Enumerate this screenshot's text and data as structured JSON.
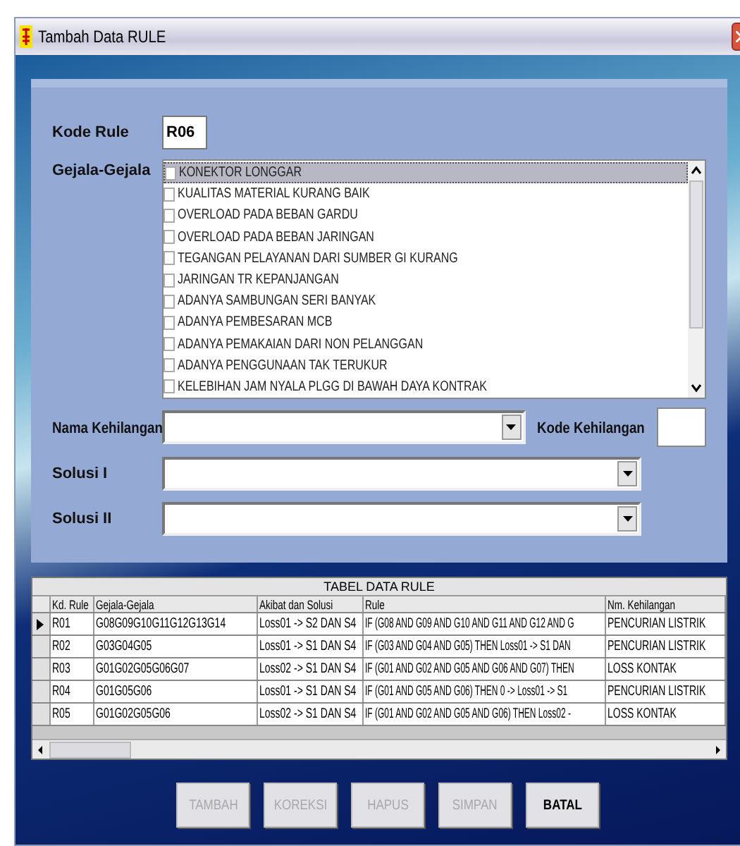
{
  "window": {
    "title": "Tambah Data RULE"
  },
  "form": {
    "kode_rule": {
      "label": "Kode Rule",
      "value": "R06"
    },
    "gejala": {
      "label": "Gejala-Gejala",
      "items": [
        {
          "label": "KONEKTOR LONGGAR",
          "checked": false,
          "selected": true
        },
        {
          "label": "KUALITAS MATERIAL KURANG BAIK",
          "checked": false,
          "selected": false
        },
        {
          "label": "OVERLOAD PADA BEBAN GARDU",
          "checked": false,
          "selected": false
        },
        {
          "label": "OVERLOAD PADA BEBAN JARINGAN",
          "checked": false,
          "selected": false
        },
        {
          "label": "TEGANGAN PELAYANAN DARI SUMBER GI KURANG",
          "checked": false,
          "selected": false
        },
        {
          "label": "JARINGAN TR KEPANJANGAN",
          "checked": false,
          "selected": false
        },
        {
          "label": "ADANYA SAMBUNGAN SERI BANYAK",
          "checked": false,
          "selected": false
        },
        {
          "label": "ADANYA PEMBESARAN MCB",
          "checked": false,
          "selected": false
        },
        {
          "label": "ADANYA PEMAKAIAN DARI NON PELANGGAN",
          "checked": false,
          "selected": false
        },
        {
          "label": "ADANYA PENGGUNAAN TAK TERUKUR",
          "checked": false,
          "selected": false
        },
        {
          "label": "KELEBIHAN JAM NYALA PLGG DI BAWAH DAYA KONTRAK",
          "checked": false,
          "selected": false
        }
      ]
    },
    "nama_kehilangan": {
      "label": "Nama Kehilangan"
    },
    "kode_kehilangan": {
      "label": "Kode Kehilangan"
    },
    "solusi_1": {
      "label": "Solusi I"
    },
    "solusi_2": {
      "label": "Solusi II"
    }
  },
  "table": {
    "title": "TABEL DATA RULE",
    "columns": [
      "Kd. Rule",
      "Gejala-Gejala",
      "Akibat dan Solusi",
      "Rule",
      "Nm. Kehilangan"
    ],
    "rows": [
      {
        "selected": true,
        "cells": [
          "R01",
          "G08G09G10G11G12G13G14",
          "Loss01 -> S2 DAN S4",
          "IF (G08 AND G09 AND G10 AND G11 AND G12 AND G",
          "PENCURIAN LISTRIK"
        ]
      },
      {
        "selected": false,
        "cells": [
          "R02",
          "G03G04G05",
          "Loss01 -> S1 DAN S4",
          "IF (G03 AND G04 AND G05) THEN Loss01 -> S1 DAN",
          "PENCURIAN LISTRIK"
        ]
      },
      {
        "selected": false,
        "cells": [
          "R03",
          "G01G02G05G06G07",
          "Loss02 -> S1 DAN S4",
          "IF (G01 AND G02 AND G05 AND G06 AND G07) THEN",
          "LOSS KONTAK"
        ]
      },
      {
        "selected": false,
        "cells": [
          "R04",
          "G01G05G06",
          "Loss01 -> S1 DAN S4",
          "IF (G01 AND G05 AND G06) THEN 0 -> Loss01 -> S1",
          "PENCURIAN LISTRIK"
        ]
      },
      {
        "selected": false,
        "cells": [
          "R05",
          "G01G02G05G06",
          "Loss02 -> S1 DAN S4",
          "IF (G01 AND G02 AND G05 AND G06) THEN Loss02 -",
          "LOSS KONTAK"
        ]
      }
    ]
  },
  "buttons": [
    {
      "label": "TAMBAH",
      "disabled": true
    },
    {
      "label": "KOREKSI",
      "disabled": true
    },
    {
      "label": "HAPUS",
      "disabled": true
    },
    {
      "label": "SIMPAN",
      "disabled": true
    },
    {
      "label": "BATAL",
      "disabled": false
    }
  ]
}
